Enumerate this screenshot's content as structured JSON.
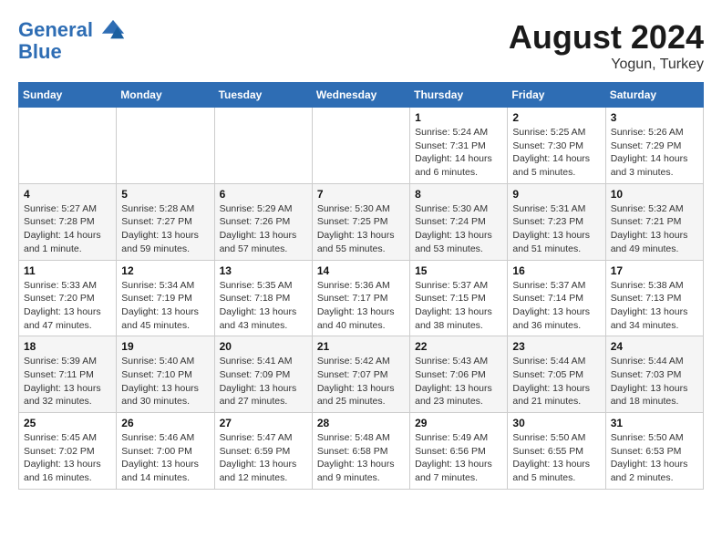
{
  "header": {
    "logo_line1": "General",
    "logo_line2": "Blue",
    "month": "August 2024",
    "location": "Yogun, Turkey"
  },
  "weekdays": [
    "Sunday",
    "Monday",
    "Tuesday",
    "Wednesday",
    "Thursday",
    "Friday",
    "Saturday"
  ],
  "weeks": [
    [
      {
        "day": "",
        "info": ""
      },
      {
        "day": "",
        "info": ""
      },
      {
        "day": "",
        "info": ""
      },
      {
        "day": "",
        "info": ""
      },
      {
        "day": "1",
        "info": "Sunrise: 5:24 AM\nSunset: 7:31 PM\nDaylight: 14 hours\nand 6 minutes."
      },
      {
        "day": "2",
        "info": "Sunrise: 5:25 AM\nSunset: 7:30 PM\nDaylight: 14 hours\nand 5 minutes."
      },
      {
        "day": "3",
        "info": "Sunrise: 5:26 AM\nSunset: 7:29 PM\nDaylight: 14 hours\nand 3 minutes."
      }
    ],
    [
      {
        "day": "4",
        "info": "Sunrise: 5:27 AM\nSunset: 7:28 PM\nDaylight: 14 hours\nand 1 minute."
      },
      {
        "day": "5",
        "info": "Sunrise: 5:28 AM\nSunset: 7:27 PM\nDaylight: 13 hours\nand 59 minutes."
      },
      {
        "day": "6",
        "info": "Sunrise: 5:29 AM\nSunset: 7:26 PM\nDaylight: 13 hours\nand 57 minutes."
      },
      {
        "day": "7",
        "info": "Sunrise: 5:30 AM\nSunset: 7:25 PM\nDaylight: 13 hours\nand 55 minutes."
      },
      {
        "day": "8",
        "info": "Sunrise: 5:30 AM\nSunset: 7:24 PM\nDaylight: 13 hours\nand 53 minutes."
      },
      {
        "day": "9",
        "info": "Sunrise: 5:31 AM\nSunset: 7:23 PM\nDaylight: 13 hours\nand 51 minutes."
      },
      {
        "day": "10",
        "info": "Sunrise: 5:32 AM\nSunset: 7:21 PM\nDaylight: 13 hours\nand 49 minutes."
      }
    ],
    [
      {
        "day": "11",
        "info": "Sunrise: 5:33 AM\nSunset: 7:20 PM\nDaylight: 13 hours\nand 47 minutes."
      },
      {
        "day": "12",
        "info": "Sunrise: 5:34 AM\nSunset: 7:19 PM\nDaylight: 13 hours\nand 45 minutes."
      },
      {
        "day": "13",
        "info": "Sunrise: 5:35 AM\nSunset: 7:18 PM\nDaylight: 13 hours\nand 43 minutes."
      },
      {
        "day": "14",
        "info": "Sunrise: 5:36 AM\nSunset: 7:17 PM\nDaylight: 13 hours\nand 40 minutes."
      },
      {
        "day": "15",
        "info": "Sunrise: 5:37 AM\nSunset: 7:15 PM\nDaylight: 13 hours\nand 38 minutes."
      },
      {
        "day": "16",
        "info": "Sunrise: 5:37 AM\nSunset: 7:14 PM\nDaylight: 13 hours\nand 36 minutes."
      },
      {
        "day": "17",
        "info": "Sunrise: 5:38 AM\nSunset: 7:13 PM\nDaylight: 13 hours\nand 34 minutes."
      }
    ],
    [
      {
        "day": "18",
        "info": "Sunrise: 5:39 AM\nSunset: 7:11 PM\nDaylight: 13 hours\nand 32 minutes."
      },
      {
        "day": "19",
        "info": "Sunrise: 5:40 AM\nSunset: 7:10 PM\nDaylight: 13 hours\nand 30 minutes."
      },
      {
        "day": "20",
        "info": "Sunrise: 5:41 AM\nSunset: 7:09 PM\nDaylight: 13 hours\nand 27 minutes."
      },
      {
        "day": "21",
        "info": "Sunrise: 5:42 AM\nSunset: 7:07 PM\nDaylight: 13 hours\nand 25 minutes."
      },
      {
        "day": "22",
        "info": "Sunrise: 5:43 AM\nSunset: 7:06 PM\nDaylight: 13 hours\nand 23 minutes."
      },
      {
        "day": "23",
        "info": "Sunrise: 5:44 AM\nSunset: 7:05 PM\nDaylight: 13 hours\nand 21 minutes."
      },
      {
        "day": "24",
        "info": "Sunrise: 5:44 AM\nSunset: 7:03 PM\nDaylight: 13 hours\nand 18 minutes."
      }
    ],
    [
      {
        "day": "25",
        "info": "Sunrise: 5:45 AM\nSunset: 7:02 PM\nDaylight: 13 hours\nand 16 minutes."
      },
      {
        "day": "26",
        "info": "Sunrise: 5:46 AM\nSunset: 7:00 PM\nDaylight: 13 hours\nand 14 minutes."
      },
      {
        "day": "27",
        "info": "Sunrise: 5:47 AM\nSunset: 6:59 PM\nDaylight: 13 hours\nand 12 minutes."
      },
      {
        "day": "28",
        "info": "Sunrise: 5:48 AM\nSunset: 6:58 PM\nDaylight: 13 hours\nand 9 minutes."
      },
      {
        "day": "29",
        "info": "Sunrise: 5:49 AM\nSunset: 6:56 PM\nDaylight: 13 hours\nand 7 minutes."
      },
      {
        "day": "30",
        "info": "Sunrise: 5:50 AM\nSunset: 6:55 PM\nDaylight: 13 hours\nand 5 minutes."
      },
      {
        "day": "31",
        "info": "Sunrise: 5:50 AM\nSunset: 6:53 PM\nDaylight: 13 hours\nand 2 minutes."
      }
    ]
  ]
}
